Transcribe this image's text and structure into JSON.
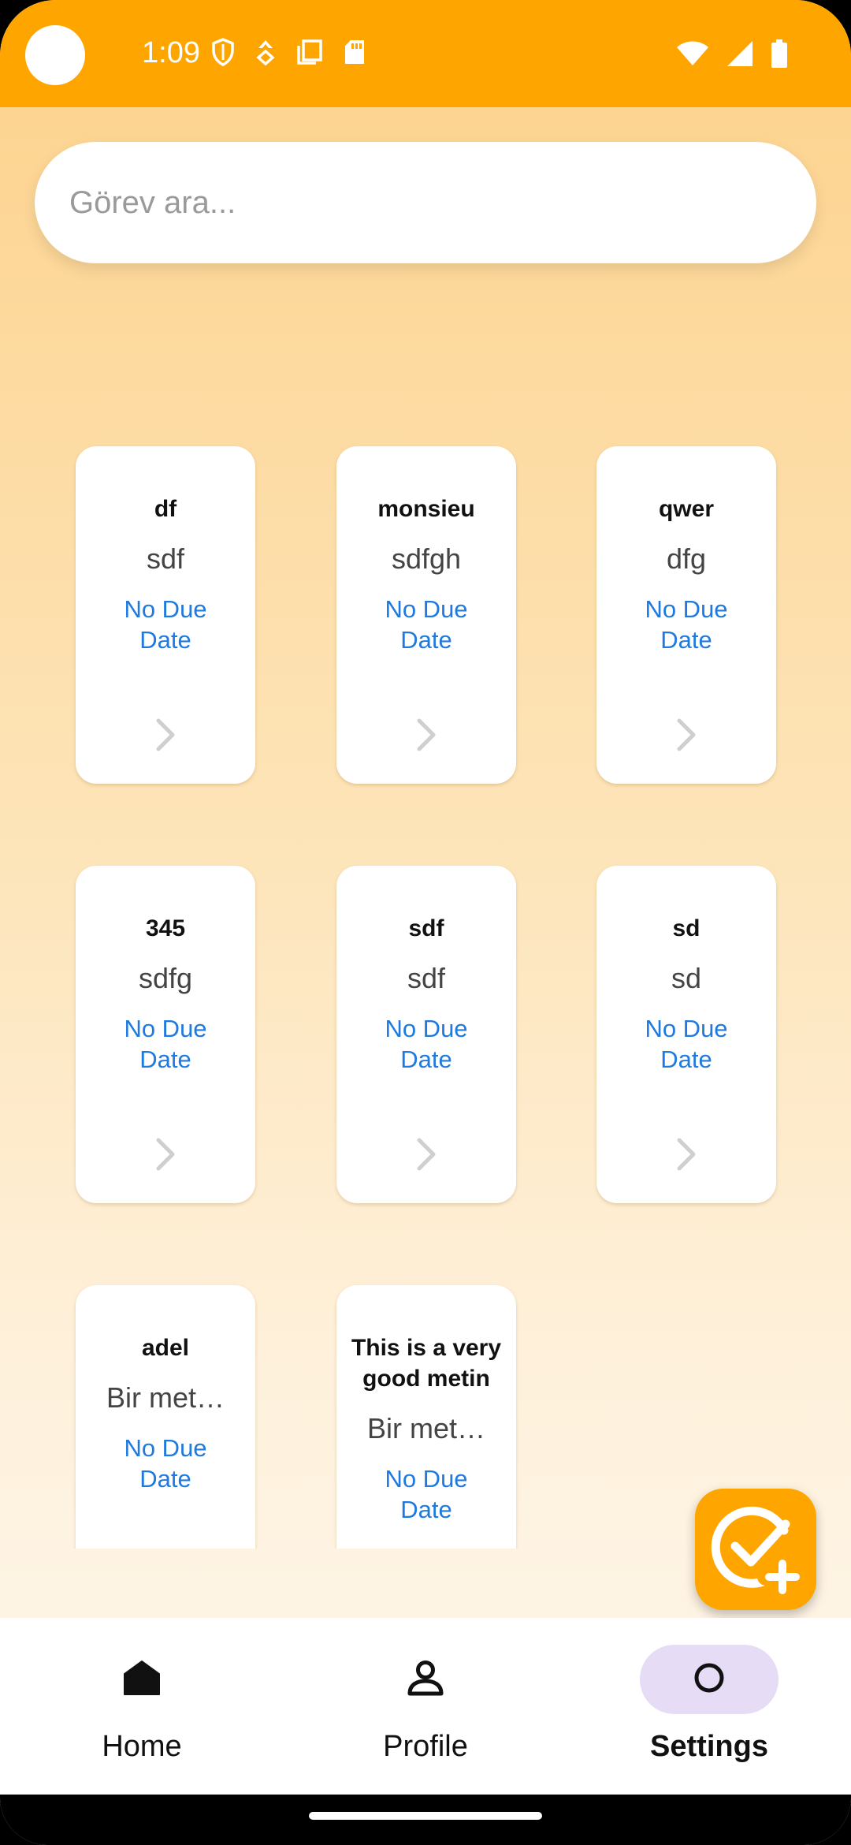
{
  "status_bar": {
    "time": "1:09",
    "background_color": "#ffa500",
    "left_icons": [
      "shield-icon",
      "navigation-icon",
      "copy-icon",
      "sd-card-icon"
    ],
    "right_icons": [
      "wifi-icon",
      "signal-icon",
      "battery-icon"
    ]
  },
  "search": {
    "placeholder": "Görev ara...",
    "value": ""
  },
  "tasks": [
    {
      "title": "df",
      "description": "sdf",
      "due": "No Due Date"
    },
    {
      "title": "monsieu",
      "description": "sdfgh",
      "due": "No Due Date"
    },
    {
      "title": "qwer",
      "description": "dfg",
      "due": "No Due Date"
    },
    {
      "title": "345",
      "description": "sdfg",
      "due": "No Due Date"
    },
    {
      "title": "sdf",
      "description": "sdf",
      "due": "No Due Date"
    },
    {
      "title": "sd",
      "description": "sd",
      "due": "No Due Date"
    },
    {
      "title": "adel",
      "description": "Bir met…",
      "due": "No Due Date"
    },
    {
      "title": "This is a very good metin",
      "description": "Bir met…",
      "due": "No Due Date"
    }
  ],
  "fab": {
    "icon": "task-add-icon",
    "color": "#ffa500"
  },
  "nav": {
    "items": [
      {
        "label": "Home",
        "icon": "home-icon",
        "active": false
      },
      {
        "label": "Profile",
        "icon": "person-icon",
        "active": false
      },
      {
        "label": "Settings",
        "icon": "circle-icon",
        "active": true
      }
    ],
    "active_indicator_color": "#e6dcf5"
  },
  "colors": {
    "accent": "#ffa500",
    "due_text": "#1f7ae0"
  }
}
